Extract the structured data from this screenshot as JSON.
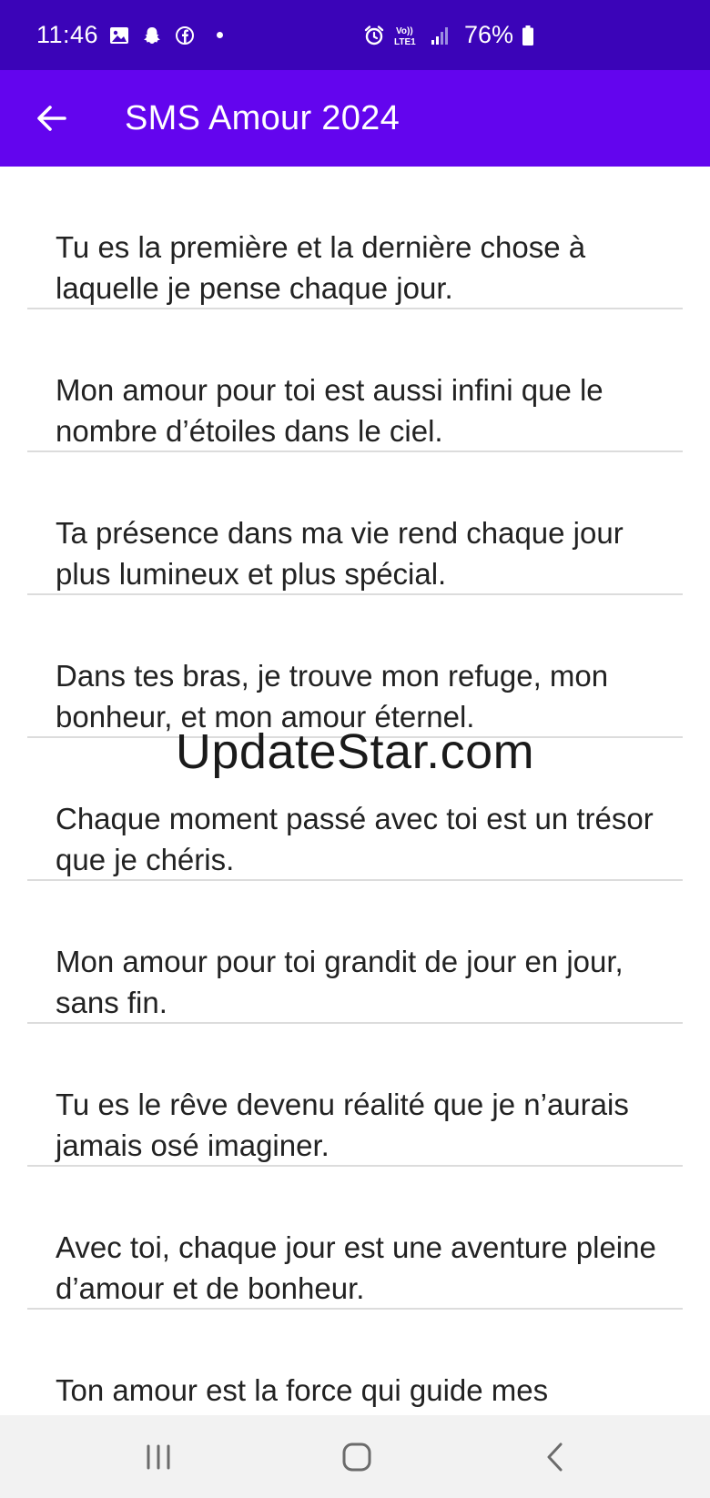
{
  "status_bar": {
    "time": "11:46",
    "battery_percent": "76%",
    "left_icons": [
      "gallery-icon",
      "snapchat-icon",
      "facebook-icon",
      "notification-dot"
    ],
    "right_icons": [
      "alarm-icon",
      "volte-icon",
      "signal-icon",
      "battery-icon"
    ],
    "volte_label_top": "Vo))",
    "volte_label_bottom": "LTE1",
    "background_color": "#3b04b8"
  },
  "app_bar": {
    "title": "SMS Amour 2024",
    "back_icon": "arrow-back-icon",
    "background_color": "#6305ee"
  },
  "messages": [
    "Tu es la première et la dernière chose à laquelle je pense chaque jour.",
    "Mon amour pour toi est aussi infini que le nombre d’étoiles dans le ciel.",
    "Ta présence dans ma vie rend chaque jour plus lumineux et plus spécial.",
    "Dans tes bras, je trouve mon refuge, mon bonheur, et mon amour éternel.",
    "Chaque moment passé avec toi est un trésor que je chéris.",
    "Mon amour pour toi grandit de jour en jour, sans fin.",
    "Tu es le rêve devenu réalité que je n’aurais jamais osé imaginer.",
    "Avec toi, chaque jour est une aventure pleine d’amour et de bonheur.",
    "Ton amour est la force qui guide mes"
  ],
  "watermark": "UpdateStar.com",
  "nav_bar": {
    "buttons": [
      "recents-icon",
      "home-icon",
      "back-icon"
    ]
  }
}
